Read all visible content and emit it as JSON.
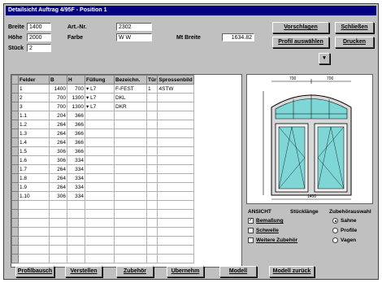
{
  "window": {
    "title": "Detailsicht Auftrag 4/95F - Position 1"
  },
  "form": {
    "breite_label": "Breite",
    "breite_value": "1400",
    "hoehe_label": "Höhe",
    "hoehe_value": "2000",
    "stueck_label": "Stück",
    "stueck_value": "2",
    "artnr_label": "Art.-Nr.",
    "artnr_value": "2302",
    "farbe_label": "Farbe",
    "farbe_value": "W W",
    "mbreite_label": "Mt Breite",
    "mbreite_value": "1634.82"
  },
  "buttons": {
    "vorschlagen": "Vorschlagen",
    "profil_auswaehlen": "Profil auswählen",
    "schliessen": "Schließen",
    "drucken": "Drucken",
    "arrow": "▾"
  },
  "table": {
    "headers": [
      "Felder",
      "B",
      "H",
      "Füllung",
      "Bezeichn.",
      "Tür",
      "Sprossenbild"
    ],
    "rows": [
      [
        "1",
        "1400",
        "700",
        "▾ L7",
        "F-FEST",
        "1",
        "4STW"
      ],
      [
        "2",
        "700",
        "1300",
        "▾ L7",
        "DKL",
        "",
        ""
      ],
      [
        "3",
        "700",
        "1300",
        "▾ L7",
        "DKR",
        "",
        ""
      ],
      [
        "1.1",
        "204",
        "366",
        "",
        "",
        "",
        ""
      ],
      [
        "1.2",
        "264",
        "366",
        "",
        "",
        "",
        ""
      ],
      [
        "1.3",
        "264",
        "366",
        "",
        "",
        "",
        ""
      ],
      [
        "1.4",
        "264",
        "366",
        "",
        "",
        "",
        ""
      ],
      [
        "1.5",
        "306",
        "366",
        "",
        "",
        "",
        ""
      ],
      [
        "1.6",
        "306",
        "334",
        "",
        "",
        "",
        ""
      ],
      [
        "1.7",
        "264",
        "334",
        "",
        "",
        "",
        ""
      ],
      [
        "1.8",
        "264",
        "334",
        "",
        "",
        "",
        ""
      ],
      [
        "1.9",
        "264",
        "334",
        "",
        "",
        "",
        ""
      ],
      [
        "1.10",
        "306",
        "334",
        "",
        "",
        "",
        ""
      ],
      [
        "",
        "",
        "",
        "",
        "",
        "",
        ""
      ],
      [
        "",
        "",
        "",
        "",
        "",
        "",
        ""
      ],
      [
        "",
        "",
        "",
        "",
        "",
        "",
        ""
      ],
      [
        "",
        "",
        "",
        "",
        "",
        "",
        ""
      ],
      [
        "",
        "",
        "",
        "",
        "",
        "",
        ""
      ],
      [
        "",
        "",
        "",
        "",
        "",
        "",
        ""
      ],
      [
        "",
        "",
        "",
        "",
        "",
        "",
        ""
      ]
    ]
  },
  "drawing": {
    "dim_top_left": "700",
    "dim_top_right": "700",
    "dim_bottom": "1400",
    "ansicht_label": "ANSICHT",
    "scale_label": "Stücklänge",
    "options_title": "Zubehörauswahl"
  },
  "options": {
    "bemassung": "Bemaßung",
    "bemassung_checked": true,
    "schwelle": "Schwelle",
    "schwelle_checked": false,
    "weiteres": "Weitere Zubehör",
    "weiteres_checked": false,
    "radio1": "Sahne",
    "radio1_on": true,
    "radio2": "Profile",
    "radio2_on": false,
    "radio3": "Vagen",
    "radio3_on": false
  },
  "bottom_buttons": [
    "Profilbausch",
    "Verstellen",
    "Zubehör",
    "Ubernehm",
    "Modell",
    "Modell zurück"
  ]
}
